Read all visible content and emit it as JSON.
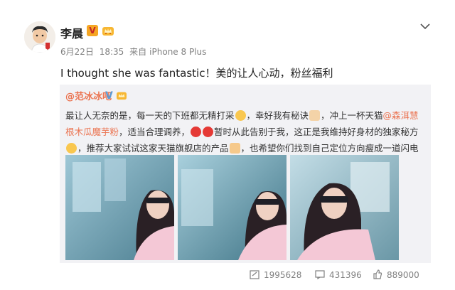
{
  "post": {
    "username": "李晨",
    "verified_badge": "V",
    "date": "6月22日",
    "time": "18:35",
    "source_prefix": "来自",
    "source": "iPhone 8 Plus",
    "text": "I thought she was fantastic！美的让人心动，粉丝福利"
  },
  "repost": {
    "author": "@范冰冰吧",
    "verified_badge": "V",
    "segments": {
      "s1": "最让人无奈的是，每一天的下班都无精打采",
      "s2": "，幸好我有秘诀",
      "s3": "，冲上一杯天猫",
      "link1": "@森洱慧根木瓜魔芋粉",
      "s4": "，适当合理调养，",
      "s5": "暂时从此告别于我，这正是我维持好身材的独家秘方",
      "s6": "，推荐大家试试这家天猫旗舰店的产品",
      "s7": "，也希望你们找到自己定位方向瘦成一道闪电"
    }
  },
  "actions": {
    "repost_count": "1995628",
    "comment_count": "431396",
    "like_count": "889000"
  },
  "colors": {
    "accent": "#eb7350",
    "muted": "#808080",
    "repost_bg": "#f2f2f5",
    "v_gold": "#f5a623",
    "v_blue": "#5b9bd5"
  },
  "icons": [
    "chevron-down-icon",
    "verified-icon",
    "crown-icon",
    "repost-icon",
    "comment-icon",
    "like-icon"
  ]
}
